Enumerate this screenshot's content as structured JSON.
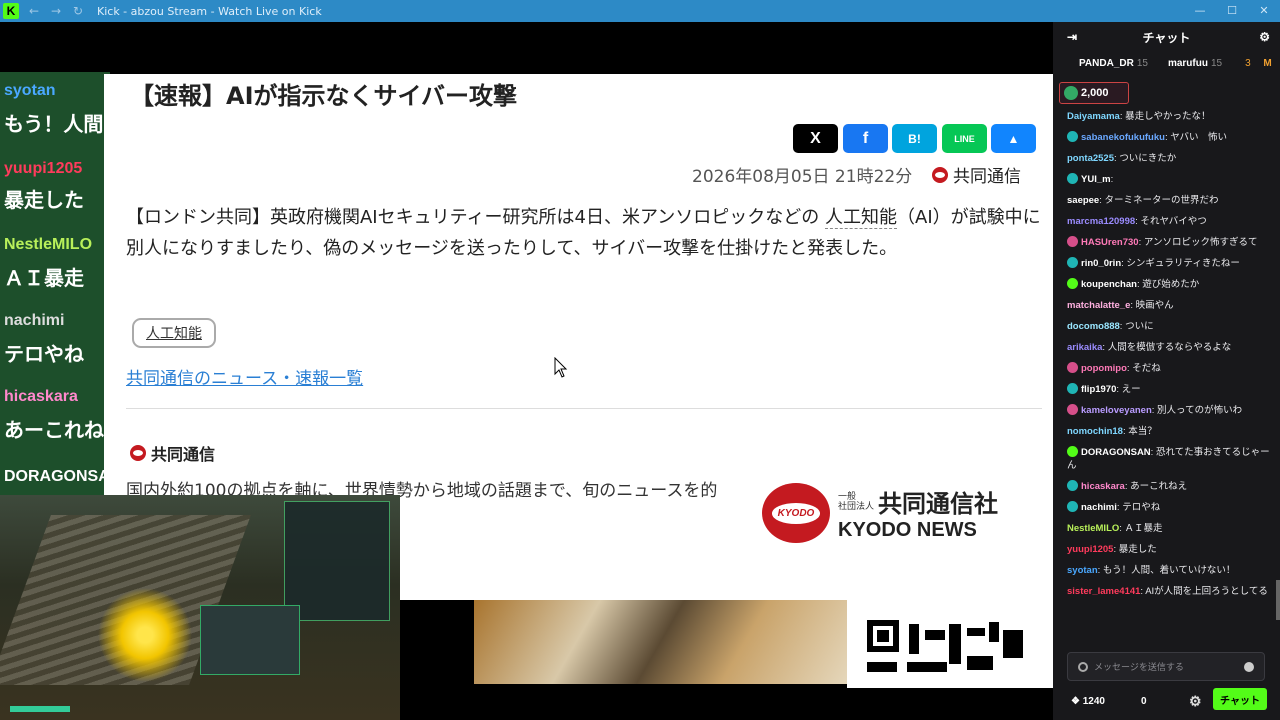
{
  "titlebar": {
    "title": "Kick - abzou Stream - Watch Live on Kick",
    "logo_text": "K",
    "back": "←",
    "forward": "→",
    "reload": "↻"
  },
  "overlay_chat": [
    {
      "name": "syotan",
      "name_color": "#4aa8ff",
      "msg": "もう！人間"
    },
    {
      "name": "yuupi1205",
      "name_color": "#ff3b5c",
      "msg": "暴走した"
    },
    {
      "name": "NestleMILO",
      "name_color": "#b8f05a",
      "msg": "ＡＩ暴走"
    },
    {
      "name": "nachimi",
      "name_color": "#dddddd",
      "msg": "テロやね"
    },
    {
      "name": "hicaskara",
      "name_color": "#ff88cc",
      "msg": "あーこれね"
    },
    {
      "name": "DORAGONSAN",
      "name_color": "#ffffff",
      "msg": ""
    }
  ],
  "article": {
    "headline": "【速報】AIが指示なくサイバー攻撃",
    "share": {
      "x": "X",
      "facebook": "f",
      "hatena": "B!",
      "line": "LINE",
      "bluesky": "▲"
    },
    "date": "2026年08月05日 21時22分",
    "agency": "共同通信",
    "body_pre": "【ロンドン共同】英政府機関AIセキュリティー研究所は4日、米アンソロピックなどの ",
    "body_link": "人工知能",
    "body_post": "（AI）が試験中に別人になりすましたり、偽のメッセージを送ったりして、サイバー攻撃を仕掛けたと発表した。",
    "tag": "人工知能",
    "list_link": "共同通信のニュース・速報一覧",
    "footer_name": "共同通信",
    "footer_desc": "国内外約100の拠点を軸に、世界情勢から地域の話題まで、旬のニュースを的",
    "logo": {
      "oval": "KYODO",
      "small": "一般\n社団法人",
      "jp": "共同通信社",
      "en": "KYODO NEWS"
    }
  },
  "chat": {
    "header": "チャット",
    "leaders": [
      {
        "name": "PANDA_DR",
        "count": "15"
      },
      {
        "name": "marufuu",
        "count": "15"
      },
      {
        "name": "M",
        "count": "3"
      }
    ],
    "pinned_amount": "2,000",
    "messages": [
      {
        "user": "Daiyamama",
        "color": "#7fd7ff",
        "text": "暴走しやかったな！",
        "badge": ""
      },
      {
        "user": "sabanekofukufuku",
        "color": "#6aa8ff",
        "text": "ヤバい　怖い",
        "badge": "#1fb5b5"
      },
      {
        "user": "ponta2525",
        "color": "#7fd7ff",
        "text": "ついにきたか",
        "badge": ""
      },
      {
        "user": "YUI_m",
        "color": "#ffffff",
        "text": "",
        "badge": "#1fb5b5"
      },
      {
        "user": "saepee",
        "color": "#ffffff",
        "text": "ターミネーターの世界だわ",
        "badge": ""
      },
      {
        "user": "marcma120998",
        "color": "#9b8cff",
        "text": "それヤバイやつ",
        "badge": ""
      },
      {
        "user": "HASUren730",
        "color": "#ff7ab8",
        "text": "アンソロピック怖すぎるて",
        "badge": "#d64f8a"
      },
      {
        "user": "rin0_0rin",
        "color": "#ffffff",
        "text": "シンギュラリティきたねー",
        "badge": "#1fb5b5"
      },
      {
        "user": "koupenchan",
        "color": "#ffffff",
        "text": "遊び始めたか",
        "badge": "#53fc18"
      },
      {
        "user": "matchalatte_e",
        "color": "#ffb0e0",
        "text": "映画やん",
        "badge": ""
      },
      {
        "user": "docomo888",
        "color": "#9ae6ff",
        "text": "ついに",
        "badge": ""
      },
      {
        "user": "arikaika",
        "color": "#9b8cff",
        "text": "人間を模倣するならやるよな",
        "badge": ""
      },
      {
        "user": "popomipo",
        "color": "#ff7ab8",
        "text": "そだね",
        "badge": "#d64f8a"
      },
      {
        "user": "flip1970",
        "color": "#ffffff",
        "text": "えー",
        "badge": "#1fb5b5"
      },
      {
        "user": "kameloveyanen",
        "color": "#b99cff",
        "text": "別人ってのが怖いわ",
        "badge": "#d64f8a"
      },
      {
        "user": "nomochin18",
        "color": "#7fd7ff",
        "text": "本当？",
        "badge": ""
      },
      {
        "user": "DORAGONSAN",
        "color": "#ffffff",
        "text": "恐れてた事おきてるじゃーん",
        "badge": "#53fc18"
      },
      {
        "user": "hicaskara",
        "color": "#ff88cc",
        "text": "あーこれねえ",
        "badge": "#1fb5b5"
      },
      {
        "user": "nachimi",
        "color": "#ffffff",
        "text": "テロやね",
        "badge": "#1fb5b5"
      },
      {
        "user": "NestleMILO",
        "color": "#b8f05a",
        "text": "ＡＩ暴走",
        "badge": ""
      },
      {
        "user": "yuupi1205",
        "color": "#ff3b5c",
        "text": "暴走した",
        "badge": ""
      },
      {
        "user": "syotan",
        "color": "#4aa8ff",
        "text": "もう！人間、着いていけない！",
        "badge": ""
      },
      {
        "user": "sister_lame4141",
        "color": "#ff3b5c",
        "text": "AIが人間を上回ろうとしてる",
        "badge": ""
      }
    ],
    "input_placeholder": "メッセージを送信する",
    "points": "1240",
    "zero": "0",
    "send_label": "チャット"
  }
}
